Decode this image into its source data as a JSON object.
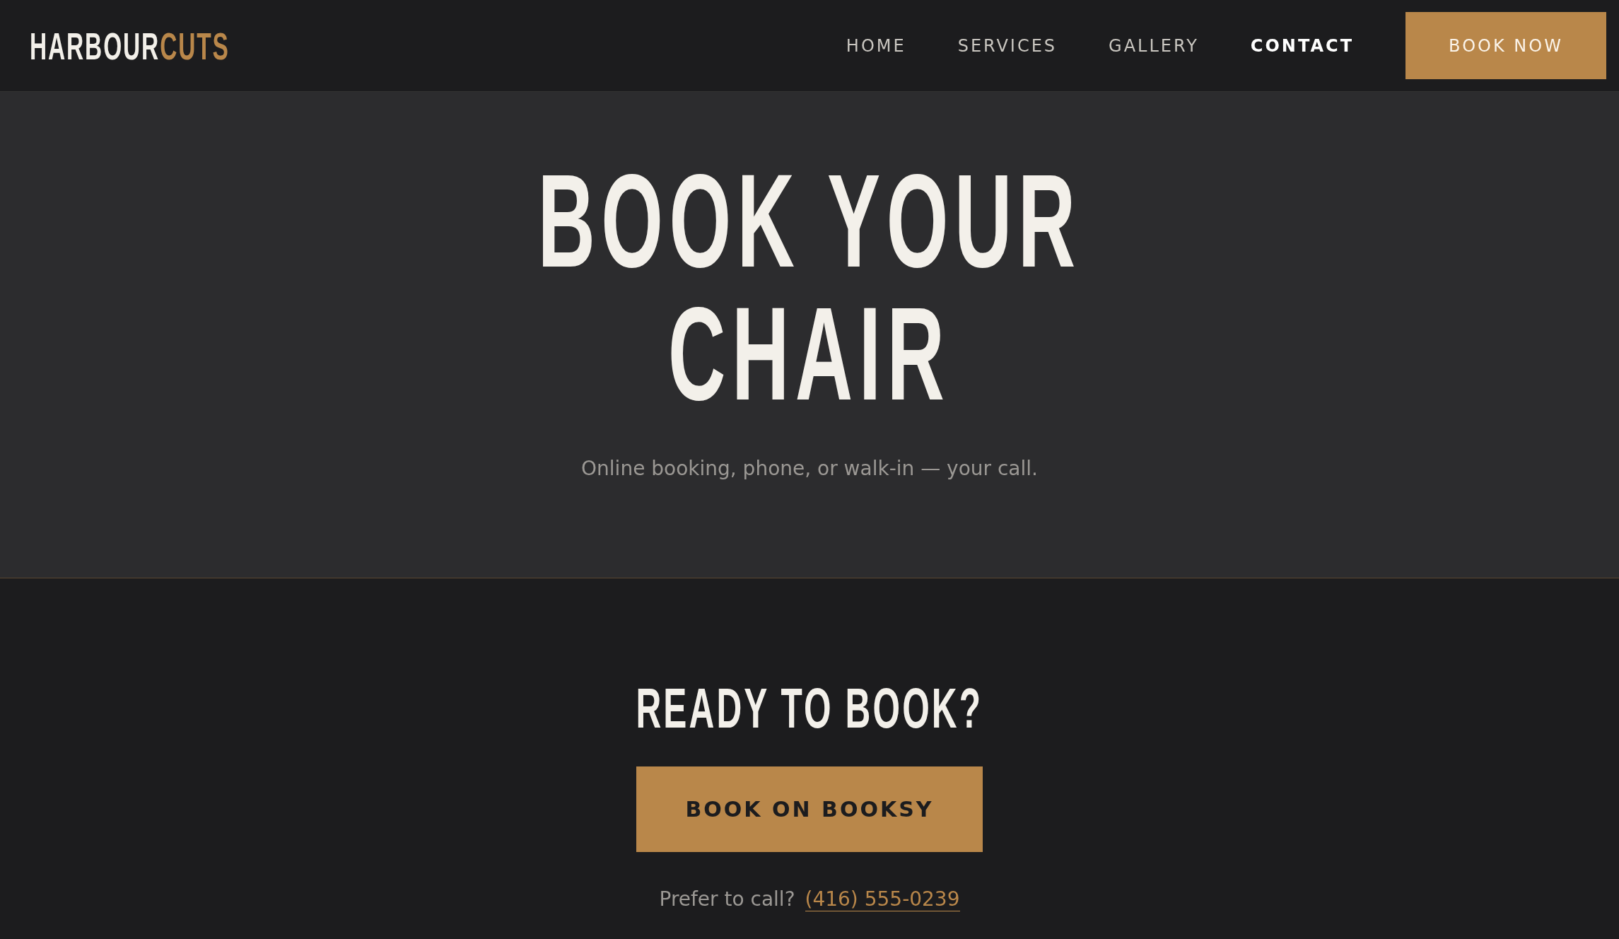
{
  "header": {
    "logo": {
      "primary": "HARBOUR",
      "accent": "CUTS"
    },
    "nav": [
      {
        "label": "HOME",
        "selected": false
      },
      {
        "label": "SERVICES",
        "selected": false
      },
      {
        "label": "GALLERY",
        "selected": false
      },
      {
        "label": "CONTACT",
        "selected": true
      }
    ],
    "cta": "BOOK NOW"
  },
  "hero": {
    "title_lines": [
      "BOOK YOUR",
      "CHAIR"
    ],
    "subtitle": "Online booking, phone, or walk-in — your call."
  },
  "booking": {
    "heading": "READY TO BOOK?",
    "button": "BOOK ON BOOKSY",
    "call_prompt": "Prefer to call?",
    "phone": "(416) 555-0239"
  }
}
